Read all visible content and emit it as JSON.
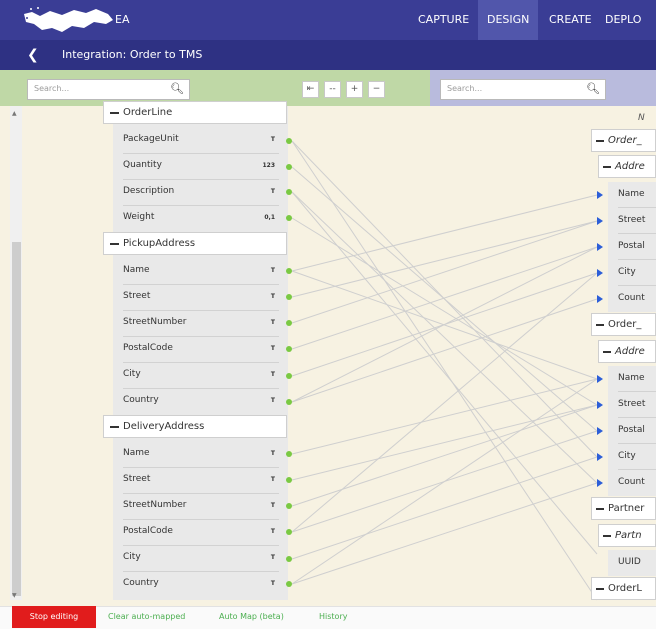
{
  "app": {
    "name": "EA",
    "nav": [
      "CAPTURE",
      "DESIGN",
      "CREATE",
      "DEPLO"
    ],
    "active_nav": "DESIGN",
    "breadcrumb": "Integration: Order to TMS"
  },
  "colors": {
    "header": "#3a3d95",
    "subheader": "#2e3183",
    "source_toolbar": "#bfd8a6",
    "target_toolbar": "#b9bbdd",
    "stop_button": "#e11c1c",
    "link_dot": "#7ac943",
    "target_arrow": "#2c5ed8"
  },
  "left_search": {
    "placeholder": "Search..."
  },
  "right_search": {
    "placeholder": "Search..."
  },
  "tools": [
    "⇤",
    "--",
    "+",
    "−"
  ],
  "source": {
    "groups": [
      {
        "name": "OrderLine",
        "fields": [
          {
            "name": "PackageUnit",
            "type": "T"
          },
          {
            "name": "Quantity",
            "type": "123"
          },
          {
            "name": "Description",
            "type": "T"
          },
          {
            "name": "Weight",
            "type": "0,1"
          }
        ]
      },
      {
        "name": "PickupAddress",
        "fields": [
          {
            "name": "Name",
            "type": "T"
          },
          {
            "name": "Street",
            "type": "T"
          },
          {
            "name": "StreetNumber",
            "type": "T"
          },
          {
            "name": "PostalCode",
            "type": "T"
          },
          {
            "name": "City",
            "type": "T"
          },
          {
            "name": "Country",
            "type": "T"
          }
        ]
      },
      {
        "name": "DeliveryAddress",
        "fields": [
          {
            "name": "Name",
            "type": "T"
          },
          {
            "name": "Street",
            "type": "T"
          },
          {
            "name": "StreetNumber",
            "type": "T"
          },
          {
            "name": "PostalCode",
            "type": "T"
          },
          {
            "name": "City",
            "type": "T"
          },
          {
            "name": "Country",
            "type": "T"
          }
        ]
      }
    ]
  },
  "target": {
    "top_text": "N",
    "items": [
      {
        "kind": "group",
        "label": "Order_"
      },
      {
        "kind": "sub",
        "label": "Addre"
      },
      {
        "kind": "field",
        "label": "Name"
      },
      {
        "kind": "field",
        "label": "Street"
      },
      {
        "kind": "field",
        "label": "Postal"
      },
      {
        "kind": "field",
        "label": "City"
      },
      {
        "kind": "field",
        "label": "Count"
      },
      {
        "kind": "group",
        "label": "Order_"
      },
      {
        "kind": "sub",
        "label": "Addre"
      },
      {
        "kind": "field",
        "label": "Name"
      },
      {
        "kind": "field",
        "label": "Street"
      },
      {
        "kind": "field",
        "label": "Postal"
      },
      {
        "kind": "field",
        "label": "City"
      },
      {
        "kind": "field",
        "label": "Count"
      },
      {
        "kind": "group",
        "label": "Partner"
      },
      {
        "kind": "sub",
        "label": "Partn"
      },
      {
        "kind": "field",
        "label": "UUID"
      },
      {
        "kind": "group",
        "label": "OrderL"
      }
    ]
  },
  "bottom": {
    "stop": "Stop editing",
    "actions": [
      "Clear auto-mapped",
      "Auto Map (beta)",
      "History"
    ]
  }
}
